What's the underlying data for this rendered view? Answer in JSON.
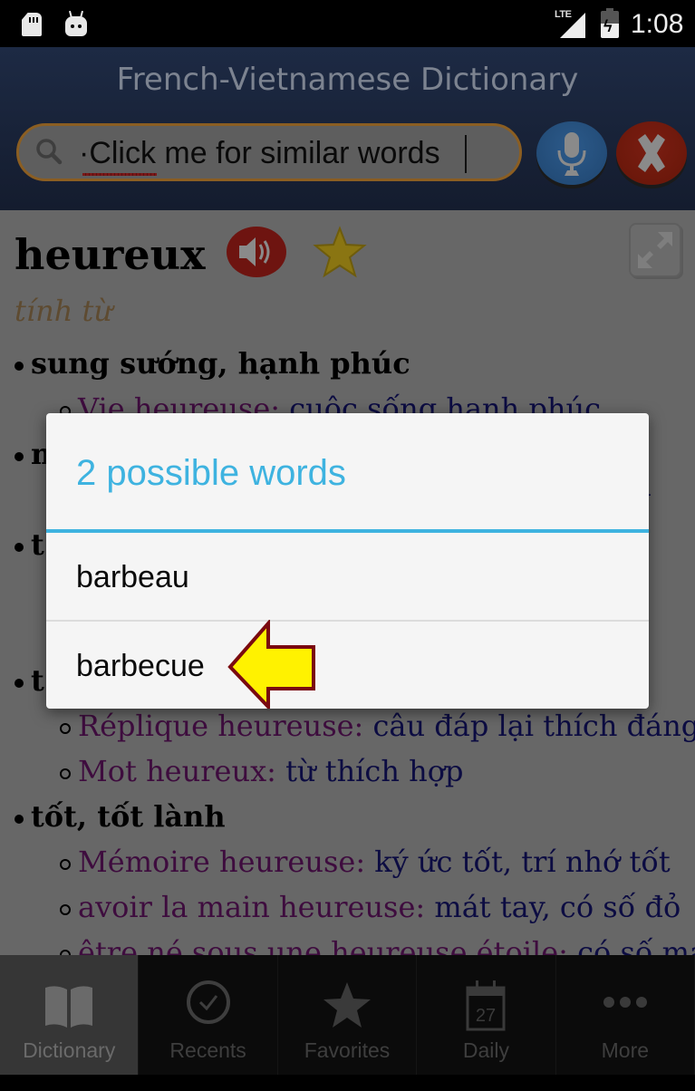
{
  "status_bar": {
    "network": "LTE",
    "time": "1:08",
    "icons": [
      "sd-card-icon",
      "android-icon",
      "lte-signal-icon",
      "battery-charging-icon"
    ]
  },
  "header": {
    "title": "French-Vietnamese Dictionary",
    "search": {
      "value": "·Click me for similar words",
      "placeholder": ""
    },
    "mic_button": "microphone-icon",
    "clear_button": "close-icon"
  },
  "entry": {
    "headword": "heureux",
    "part_of_speech": "tính từ",
    "senses": [
      {
        "meaning": "sung sướng, hạnh phúc",
        "examples": [
          {
            "fr": "Vie heureuse:",
            "vi": " cuộc sống hạnh phúc"
          }
        ]
      },
      {
        "meaning": "m",
        "examples": [
          {
            "fr": "",
            "vi": "y"
          }
        ]
      },
      {
        "meaning": "t",
        "examples": []
      },
      {
        "meaning": "t",
        "examples": [
          {
            "fr": "Réplique heureuse:",
            "vi": " câu đáp lại thích đáng"
          },
          {
            "fr": "Mot heureux:",
            "vi": " từ thích hợp"
          }
        ]
      },
      {
        "meaning": "tốt, tốt lành",
        "examples": [
          {
            "fr": "Mémoire heureuse:",
            "vi": " ký ức tốt, trí nhớ tốt"
          },
          {
            "fr": "avoir la main heureuse:",
            "vi": " mát tay, có số đỏ"
          },
          {
            "fr": "être né sous une heureuse étoile:",
            "vi": " có số may"
          }
        ]
      }
    ]
  },
  "dialog": {
    "title": "2 possible words",
    "items": [
      "barbeau",
      "barbecue"
    ],
    "highlighted_item": "barbecue",
    "accent_color": "#3eb3e0"
  },
  "bottom_nav": {
    "items": [
      {
        "label": "Dictionary",
        "icon": "book-icon",
        "active": true
      },
      {
        "label": "Recents",
        "icon": "clock-check-icon",
        "active": false
      },
      {
        "label": "Favorites",
        "icon": "star-icon",
        "active": false
      },
      {
        "label": "Daily",
        "icon": "calendar-icon",
        "calendar_day": "27",
        "active": false
      },
      {
        "label": "More",
        "icon": "more-dots-icon",
        "active": false
      }
    ]
  }
}
